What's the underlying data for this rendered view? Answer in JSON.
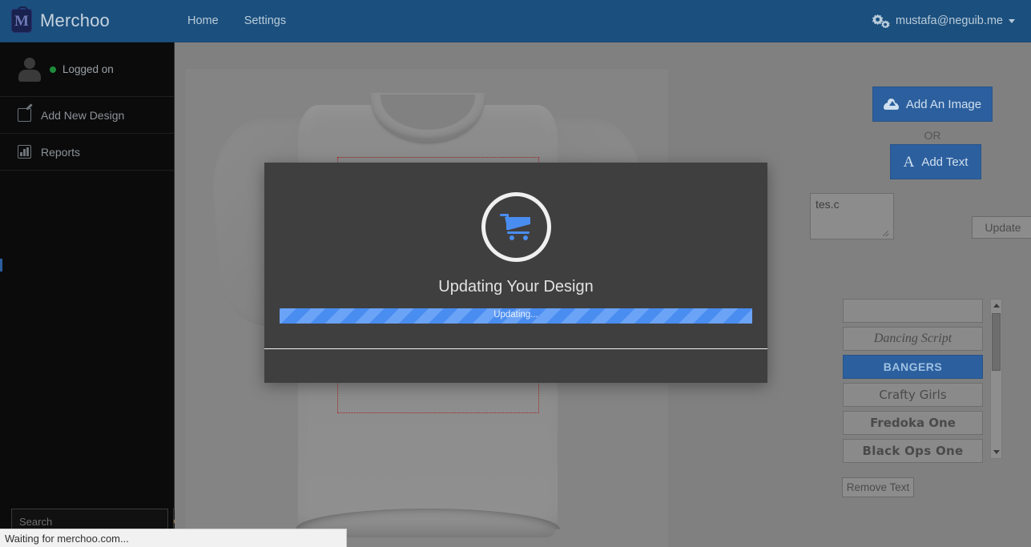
{
  "navbar": {
    "brand": "Merchoo",
    "links": [
      {
        "label": "Home"
      },
      {
        "label": "Settings"
      }
    ],
    "account_email": "mustafa@neguib.me",
    "gear_icon": "gears-icon",
    "caret_icon": "chevron-down-icon",
    "bg_color": "#1b4f7e"
  },
  "sidebar": {
    "status_label": "Logged on",
    "status_color": "#1c8c3b",
    "items": [
      {
        "label": "Add New Design",
        "icon": "pencil-square-icon"
      },
      {
        "label": "Reports",
        "icon": "bar-chart-icon"
      }
    ],
    "search": {
      "placeholder": "Search",
      "value": "",
      "button_icon": "search-icon"
    }
  },
  "workspace": {
    "product": "t-shirt-preview",
    "design_area_label": "design-bounds"
  },
  "tools": {
    "add_image_label": "Add An Image",
    "add_image_icon": "cloud-upload-icon",
    "or_label": "OR",
    "add_text_label": "Add Text",
    "add_text_icon": "text-A-icon",
    "text_value": "tes.c",
    "text_placeholder": "",
    "update_label": "Update",
    "remove_text_label": "Remove Text",
    "fonts": [
      {
        "label": "",
        "selected": false
      },
      {
        "label": "Dancing Script",
        "selected": false
      },
      {
        "label": "BANGERS",
        "selected": true
      },
      {
        "label": "Crafty Girls",
        "selected": false
      },
      {
        "label": "Fredoka One",
        "selected": false
      },
      {
        "label": "Black Ops One",
        "selected": false
      }
    ],
    "scroll_up_icon": "triangle-up-icon",
    "scroll_down_icon": "triangle-down-icon"
  },
  "modal": {
    "icon": "shopping-cart-icon",
    "title": "Updating Your Design",
    "progress_text": "Updating...",
    "progress_color": "#4a8df0",
    "bg_color": "#3f3f3f"
  },
  "statusbar": {
    "text": "Waiting for merchoo.com..."
  }
}
